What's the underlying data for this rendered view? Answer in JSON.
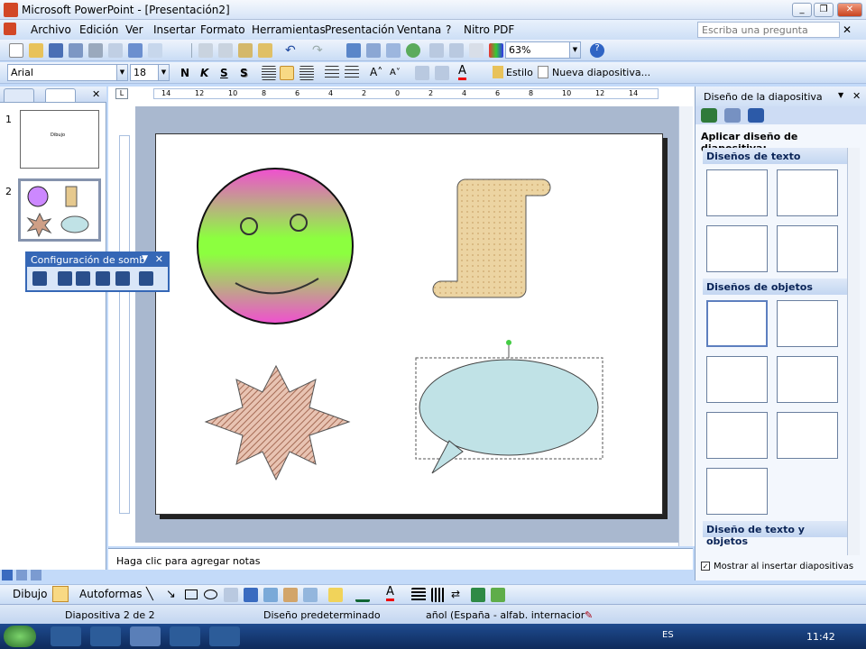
{
  "window": {
    "title": "Microsoft PowerPoint - [Presentación2]"
  },
  "menu": {
    "items": [
      "Archivo",
      "Edición",
      "Ver",
      "Insertar",
      "Formato",
      "Herramientas",
      "Presentación",
      "Ventana",
      "?",
      "Nitro PDF"
    ],
    "ask_placeholder": "Escriba una pregunta"
  },
  "toolbar": {
    "zoom": "63%"
  },
  "format": {
    "font": "Arial",
    "size": "18",
    "bold": "N",
    "italic": "K",
    "underline": "S",
    "shadow": "S",
    "style_label": "Estilo",
    "new_slide_label": "Nueva diapositiva..."
  },
  "ruler": {
    "labels": [
      "14",
      "12",
      "10",
      "8",
      "6",
      "4",
      "2",
      "0",
      "2",
      "4",
      "6",
      "8",
      "10",
      "12",
      "14"
    ]
  },
  "slides": [
    {
      "number": "1",
      "title": "Dibujo"
    },
    {
      "number": "2"
    }
  ],
  "floating_toolbar": {
    "title": "Configuración de somb"
  },
  "notes": {
    "placeholder": "Haga clic para agregar notas"
  },
  "task_pane": {
    "title": "Diseño de la diapositiva",
    "apply_label": "Aplicar diseño de diapositiva:",
    "sections": [
      "Diseños de texto",
      "Diseños de objetos",
      "Diseño de texto y objetos"
    ],
    "show_on_insert": "Mostrar al insertar diapositivas"
  },
  "drawing": {
    "draw_label": "Dibujo",
    "autoshapes_label": "Autoformas"
  },
  "status": {
    "slide": "Diapositiva 2 de 2",
    "design": "Diseño predeterminado",
    "language": "añol (España - alfab. internacior"
  },
  "taskbar": {
    "lang": "ES",
    "time": "11:42"
  },
  "colors": {
    "smiley_top": "#f04fd0",
    "smiley_mid": "#8cff3f",
    "scroll": "#f0d9a6",
    "star": "#cf9f86",
    "bubble": "#c0e2e6",
    "accent": "#3567b6"
  }
}
